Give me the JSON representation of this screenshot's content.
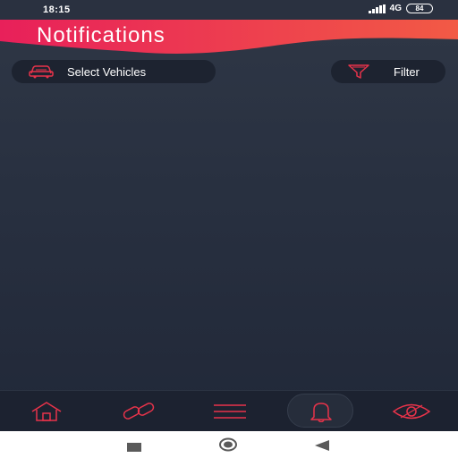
{
  "status_bar": {
    "time": "18:15",
    "network": "4G",
    "battery": "84"
  },
  "header": {
    "title": "Notifications"
  },
  "toolbar": {
    "select_vehicles_label": "Select Vehicles",
    "filter_label": "Filter"
  },
  "bottom_nav": {
    "items": [
      {
        "icon": "home-icon"
      },
      {
        "icon": "link-icon"
      },
      {
        "icon": "menu-icon"
      },
      {
        "icon": "bell-icon",
        "active": true
      },
      {
        "icon": "eye-icon"
      }
    ]
  },
  "colors": {
    "accent": "#e8334a",
    "gradient_start": "#e8205a",
    "gradient_end": "#f25a45",
    "background": "#283040",
    "nav_background": "#1c2230"
  }
}
